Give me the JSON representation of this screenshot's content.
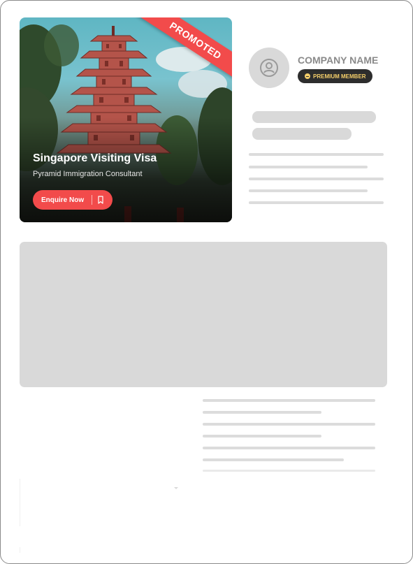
{
  "promo": {
    "ribbon": "PROMOTED",
    "title": "Singapore Visiting Visa",
    "subtitle": "Pyramid Immigration Consultant",
    "cta_label": "Enquire Now",
    "cta_icon": "bookmark-icon",
    "accent": "#f24b4b"
  },
  "company": {
    "avatar_icon": "user-icon",
    "name": "COMPANY NAME",
    "badge": "PREMIUM MEMBER",
    "badge_color": "#f5cf6a"
  },
  "colors": {
    "placeholder": "#d9d9d9",
    "line": "#dcdcdc"
  }
}
